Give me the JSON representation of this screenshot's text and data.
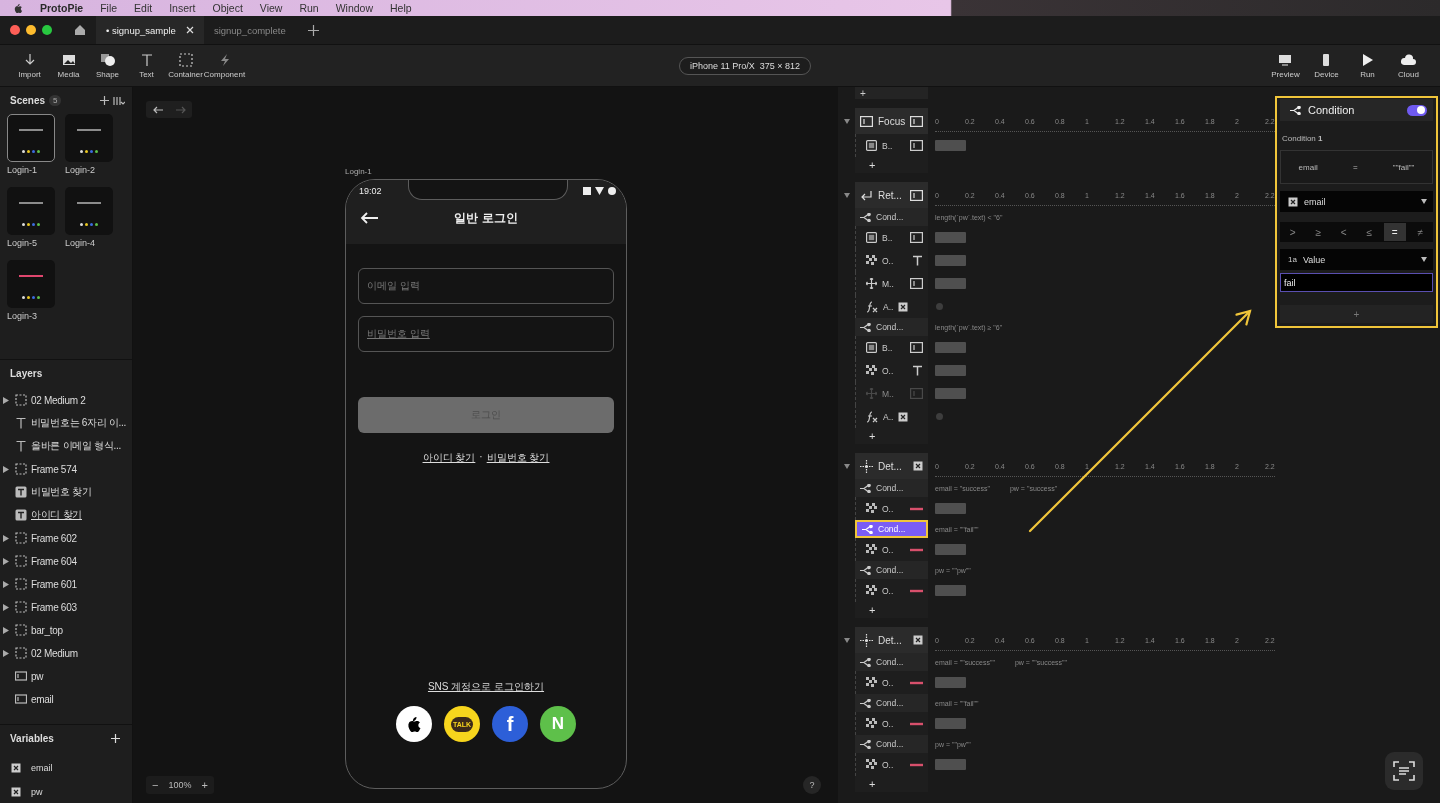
{
  "menu_bar": {
    "app_name": "ProtoPie",
    "items": [
      "File",
      "Edit",
      "Insert",
      "Object",
      "View",
      "Run",
      "Window",
      "Help"
    ]
  },
  "tabs": [
    {
      "label": "• signup_sample",
      "selected": true
    },
    {
      "label": "signup_complete",
      "selected": false
    }
  ],
  "toolbar": {
    "tools": [
      {
        "kind": "import",
        "label": "Import"
      },
      {
        "kind": "media",
        "label": "Media"
      },
      {
        "kind": "shape",
        "label": "Shape"
      },
      {
        "kind": "text",
        "label": "Text"
      },
      {
        "kind": "container",
        "label": "Container"
      },
      {
        "kind": "component",
        "label": "Component"
      }
    ],
    "device": "iPhone 11 Pro/X  375 × 812",
    "actions": [
      {
        "kind": "preview",
        "label": "Preview"
      },
      {
        "kind": "device",
        "label": "Device"
      },
      {
        "kind": "run",
        "label": "Run"
      },
      {
        "kind": "cloud",
        "label": "Cloud"
      }
    ]
  },
  "scenes": {
    "title": "Scenes",
    "count": "5",
    "items": [
      {
        "name": "Login-1",
        "selected": true,
        "color": "#8c8c8c"
      },
      {
        "name": "Login-2",
        "selected": false,
        "color": "#8c8c8c"
      },
      {
        "name": "Login-5",
        "selected": false,
        "color": "#8c8c8c"
      },
      {
        "name": "Login-4",
        "selected": false,
        "color": "#8c8c8c"
      },
      {
        "name": "Login-3",
        "selected": false,
        "color": "#e0466e"
      }
    ]
  },
  "layers": {
    "title": "Layers",
    "items": [
      {
        "kind": "group",
        "name": "02 Medium 2",
        "underlined": false
      },
      {
        "kind": "text",
        "name": "비밀번호는 6자리 이...",
        "underlined": false
      },
      {
        "kind": "text",
        "name": "올바른 이메일 형식...",
        "underlined": false
      },
      {
        "kind": "group",
        "name": "Frame 574",
        "underlined": false
      },
      {
        "kind": "text_box",
        "name": "비밀번호 찾기",
        "underlined": false
      },
      {
        "kind": "text_box",
        "name": "아이디 찾기",
        "underlined": true
      },
      {
        "kind": "group",
        "name": "Frame 602",
        "underlined": false
      },
      {
        "kind": "group",
        "name": "Frame 604",
        "underlined": false
      },
      {
        "kind": "group",
        "name": "Frame 601",
        "underlined": false
      },
      {
        "kind": "group",
        "name": "Frame 603",
        "underlined": false
      },
      {
        "kind": "group",
        "name": "bar_top",
        "underlined": false
      },
      {
        "kind": "group",
        "name": "02 Medium",
        "underlined": false
      },
      {
        "kind": "input",
        "name": "pw",
        "underlined": false
      },
      {
        "kind": "input",
        "name": "email",
        "underlined": false
      }
    ]
  },
  "variables": {
    "title": "Variables",
    "items": [
      "email",
      "pw"
    ]
  },
  "canvas": {
    "scene_label": "Login-1",
    "zoom_out": "−",
    "zoom": "100%",
    "zoom_in": "+",
    "help": "?",
    "phone": {
      "time": "19:02",
      "title": "일반 로그인",
      "email_placeholder": "이메일 입력",
      "password_placeholder": "비밀번호 입력",
      "login_button": {
        "label": "로그인",
        "disabled": true
      },
      "find_id": "아이디 찾기",
      "separator": "·",
      "find_password": "비밀번호 찾기",
      "sns_label": "SNS 계정으로 로그인하기",
      "sns": [
        {
          "kind": "apple"
        },
        {
          "kind": "kakao",
          "label": "TALK"
        },
        {
          "kind": "facebook",
          "label": "f"
        },
        {
          "kind": "naver",
          "label": "N"
        }
      ]
    }
  },
  "timeline": {
    "leading_add": "+",
    "triggers": [
      {
        "kind": "focus",
        "label": "Focus",
        "ruler": [
          "0",
          "0.2",
          "0.4",
          "0.6",
          "0.8",
          "1",
          "1.2",
          "1.4",
          "1.6",
          "1.8",
          "2",
          "2.2"
        ],
        "items": [
          {
            "kind": "border",
            "label": "B..",
            "disabled": false
          },
          {
            "kind": "add",
            "label": "+"
          }
        ]
      },
      {
        "kind": "return",
        "label": "Ret...",
        "ruler": [
          "0",
          "0.2",
          "0.4",
          "0.6",
          "0.8",
          "1",
          "1.2",
          "1.4",
          "1.6",
          "1.8",
          "2",
          "2.2"
        ],
        "items": [
          {
            "kind": "condition",
            "label": "Cond...",
            "expressions": [
              "length(`pw`.text) < \"6\""
            ],
            "selected": false
          },
          {
            "kind": "border",
            "label": "B..",
            "disabled": false
          },
          {
            "kind": "opacity",
            "label": "O..",
            "disabled": false
          },
          {
            "kind": "move",
            "label": "M..",
            "disabled": false
          },
          {
            "kind": "assign",
            "label": "A..",
            "disabled": false
          },
          {
            "kind": "condition",
            "label": "Cond...",
            "expressions": [
              "length(`pw`.text) ≥ \"6\""
            ],
            "selected": false
          },
          {
            "kind": "border",
            "label": "B..",
            "disabled": false
          },
          {
            "kind": "opacity",
            "label": "O..",
            "disabled": false
          },
          {
            "kind": "move",
            "label": "M..",
            "disabled": true
          },
          {
            "kind": "assign",
            "label": "A..",
            "disabled": false
          },
          {
            "kind": "add",
            "label": "+"
          }
        ]
      },
      {
        "kind": "detect",
        "label": "Det...",
        "ruler": [
          "0",
          "0.2",
          "0.4",
          "0.6",
          "0.8",
          "1",
          "1.2",
          "1.4",
          "1.6",
          "1.8",
          "2",
          "2.2"
        ],
        "items": [
          {
            "kind": "condition",
            "label": "Cond...",
            "expressions": [
              "email = \"success\"",
              "pw = \"success\""
            ],
            "selected": false
          },
          {
            "kind": "opacity",
            "label": "O..",
            "disabled": false
          },
          {
            "kind": "condition",
            "label": "Cond...",
            "expressions": [
              "email = \"\"fail\"\""
            ],
            "selected": true
          },
          {
            "kind": "opacity",
            "label": "O..",
            "disabled": false
          },
          {
            "kind": "condition",
            "label": "Cond...",
            "expressions": [
              "pw = \"\"pw\"\""
            ],
            "selected": false
          },
          {
            "kind": "opacity",
            "label": "O..",
            "disabled": false
          },
          {
            "kind": "add",
            "label": "+"
          }
        ]
      },
      {
        "kind": "detect",
        "label": "Det...",
        "ruler": [
          "0",
          "0.2",
          "0.4",
          "0.6",
          "0.8",
          "1",
          "1.2",
          "1.4",
          "1.6",
          "1.8",
          "2",
          "2.2"
        ],
        "items": [
          {
            "kind": "condition",
            "label": "Cond...",
            "expressions": [
              "email = \"\"success\"\"",
              "pw = \"\"success\"\""
            ],
            "selected": false
          },
          {
            "kind": "opacity",
            "label": "O..",
            "disabled": false
          },
          {
            "kind": "condition",
            "label": "Cond...",
            "expressions": [
              "email = \"\"fail\"\""
            ],
            "selected": false
          },
          {
            "kind": "opacity",
            "label": "O..",
            "disabled": false
          },
          {
            "kind": "condition",
            "label": "Cond...",
            "expressions": [
              "pw = \"\"pw\"\""
            ],
            "selected": false
          },
          {
            "kind": "opacity",
            "label": "O..",
            "disabled": false
          },
          {
            "kind": "add",
            "label": "+"
          }
        ]
      }
    ]
  },
  "condition_panel": {
    "title": "Condition",
    "enabled": true,
    "condition_label": "Condition **1**",
    "summary": {
      "left": "email",
      "operator": "=",
      "right": "\"\"fail\"\""
    },
    "variable": "email",
    "operators": [
      {
        "symbol": ">",
        "selected": false
      },
      {
        "symbol": "≥",
        "selected": false
      },
      {
        "symbol": "<",
        "selected": false
      },
      {
        "symbol": "≤",
        "selected": false
      },
      {
        "symbol": "=",
        "selected": true
      },
      {
        "symbol": "≠",
        "selected": false
      }
    ],
    "value_type_glyph": "1a",
    "value_type": "Value",
    "value": "fail",
    "add": "+"
  }
}
